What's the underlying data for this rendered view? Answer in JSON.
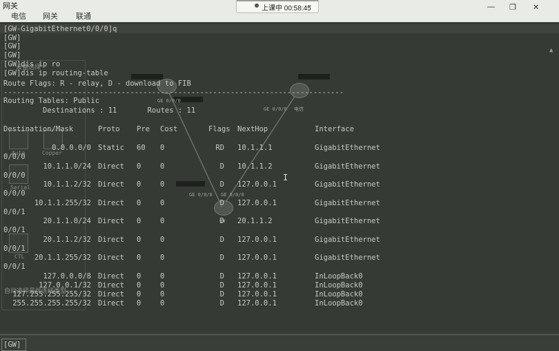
{
  "window": {
    "title": "网关"
  },
  "tabs": [
    "电信",
    "网关",
    "联通"
  ],
  "recording": {
    "status_text": "上课中 00:58:45"
  },
  "window_controls": {
    "minimize": "—",
    "restore": "❐",
    "close": "✕"
  },
  "topology": {
    "labels": [
      "设备选择",
      "Auto",
      "Copper",
      "Serial",
      "CTL",
      "GE 0/0/0",
      "GE 0/0/0",
      "GE 0/0/0",
      "GE 0/0/0",
      "GW",
      "电信"
    ],
    "tooltip": "自动选择最优连线类型"
  },
  "terminal": {
    "lines": [
      "[GW-GigabitEthernet0/0/0]q",
      "[GW]",
      "[GW]",
      "[GW]",
      "[GW]dis ip ro",
      "[GW]dis ip routing-table",
      "Route Flags: R - relay, D - download to FIB",
      "------------------------------------------------------------------------------",
      "Routing Tables: Public",
      "         Destinations : 11       Routes : 11"
    ],
    "headers": {
      "dest": "Destination/Mask",
      "proto": "Proto",
      "pre": "Pre",
      "cost": "Cost",
      "flags": "Flags",
      "nexthop": "NextHop",
      "iface": "Interface"
    },
    "routes": [
      {
        "dest": "0.0.0.0/0",
        "proto": "Static",
        "pre": "60",
        "cost": "0",
        "flags": "RD",
        "nexthop": "10.1.1.1",
        "iface": "GigabitEthernet",
        "cont": "0/0/0"
      },
      {
        "dest": "10.1.1.0/24",
        "proto": "Direct",
        "pre": "0",
        "cost": "0",
        "flags": "D",
        "nexthop": "10.1.1.2",
        "iface": "GigabitEthernet",
        "cont": "0/0/0"
      },
      {
        "dest": "10.1.1.2/32",
        "proto": "Direct",
        "pre": "0",
        "cost": "0",
        "flags": "D",
        "nexthop": "127.0.0.1",
        "iface": "GigabitEthernet",
        "cont": "0/0/0"
      },
      {
        "dest": "10.1.1.255/32",
        "proto": "Direct",
        "pre": "0",
        "cost": "0",
        "flags": "D",
        "nexthop": "127.0.0.1",
        "iface": "GigabitEthernet",
        "cont": "0/0/1"
      },
      {
        "dest": "20.1.1.0/24",
        "proto": "Direct",
        "pre": "0",
        "cost": "0",
        "flags": "D",
        "nexthop": "20.1.1.2",
        "iface": "GigabitEthernet",
        "cont": "0/0/1"
      },
      {
        "dest": "20.1.1.2/32",
        "proto": "Direct",
        "pre": "0",
        "cost": "0",
        "flags": "D",
        "nexthop": "127.0.0.1",
        "iface": "GigabitEthernet",
        "cont": "0/0/1"
      },
      {
        "dest": "20.1.1.255/32",
        "proto": "Direct",
        "pre": "0",
        "cost": "0",
        "flags": "D",
        "nexthop": "127.0.0.1",
        "iface": "GigabitEthernet",
        "cont": "0/0/1"
      },
      {
        "dest": "127.0.0.0/8",
        "proto": "Direct",
        "pre": "0",
        "cost": "0",
        "flags": "D",
        "nexthop": "127.0.0.1",
        "iface": "InLoopBack0",
        "cont": ""
      },
      {
        "dest": "127.0.0.1/32",
        "proto": "Direct",
        "pre": "0",
        "cost": "0",
        "flags": "D",
        "nexthop": "127.0.0.1",
        "iface": "InLoopBack0",
        "cont": ""
      },
      {
        "dest": "127.255.255.255/32",
        "proto": "Direct",
        "pre": "0",
        "cost": "0",
        "flags": "D",
        "nexthop": "127.0.0.1",
        "iface": "InLoopBack0",
        "cont": ""
      },
      {
        "dest": "255.255.255.255/32",
        "proto": "Direct",
        "pre": "0",
        "cost": "0",
        "flags": "D",
        "nexthop": "127.0.0.1",
        "iface": "InLoopBack0",
        "cont": ""
      }
    ],
    "input_value": "[GW]"
  }
}
